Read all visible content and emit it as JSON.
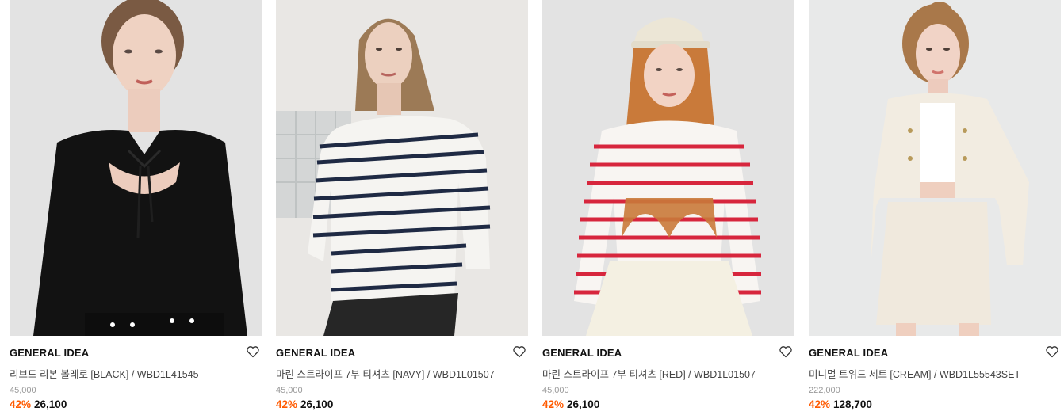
{
  "products": [
    {
      "brand": "GENERAL IDEA",
      "title": "리브드 리본 볼레로 [BLACK] / WBD1L41545",
      "original_price": "45,000",
      "discount": "42%",
      "price": "26,100",
      "wishlist_icon": "heart-outline-icon"
    },
    {
      "brand": "GENERAL IDEA",
      "title": "마린 스트라이프 7부 티셔츠 [NAVY] / WBD1L01507",
      "original_price": "45,000",
      "discount": "42%",
      "price": "26,100",
      "wishlist_icon": "heart-outline-icon"
    },
    {
      "brand": "GENERAL IDEA",
      "title": "마린 스트라이프 7부 티셔츠 [RED] / WBD1L01507",
      "original_price": "45,000",
      "discount": "42%",
      "price": "26,100",
      "wishlist_icon": "heart-outline-icon"
    },
    {
      "brand": "GENERAL IDEA",
      "title": "미니멀 트위드 세트 [CREAM] / WBD1L55543SET",
      "original_price": "222,000",
      "discount": "42%",
      "price": "128,700",
      "wishlist_icon": "heart-outline-icon"
    }
  ],
  "colors": {
    "discount": "#ff5a00",
    "price": "#111111",
    "original_price": "#9a9a9a",
    "brand": "#111111",
    "title": "#444444"
  }
}
